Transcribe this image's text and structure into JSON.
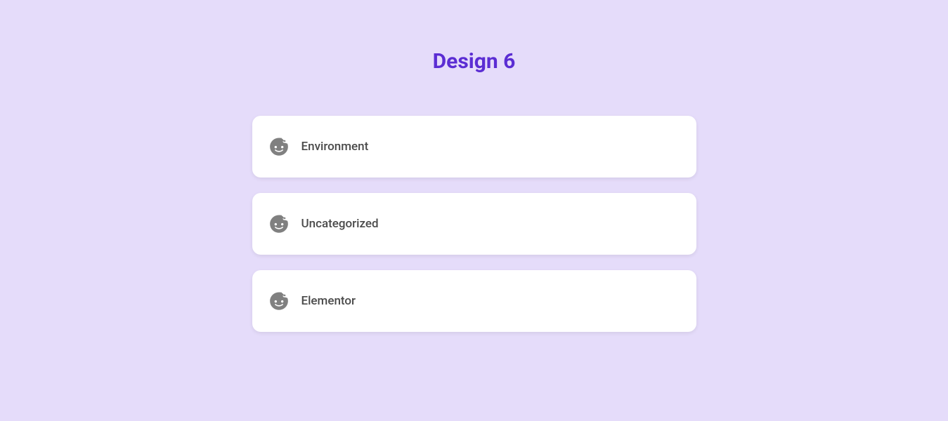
{
  "title": "Design 6",
  "items": [
    {
      "label": "Environment"
    },
    {
      "label": "Uncategorized"
    },
    {
      "label": "Elementor"
    }
  ]
}
